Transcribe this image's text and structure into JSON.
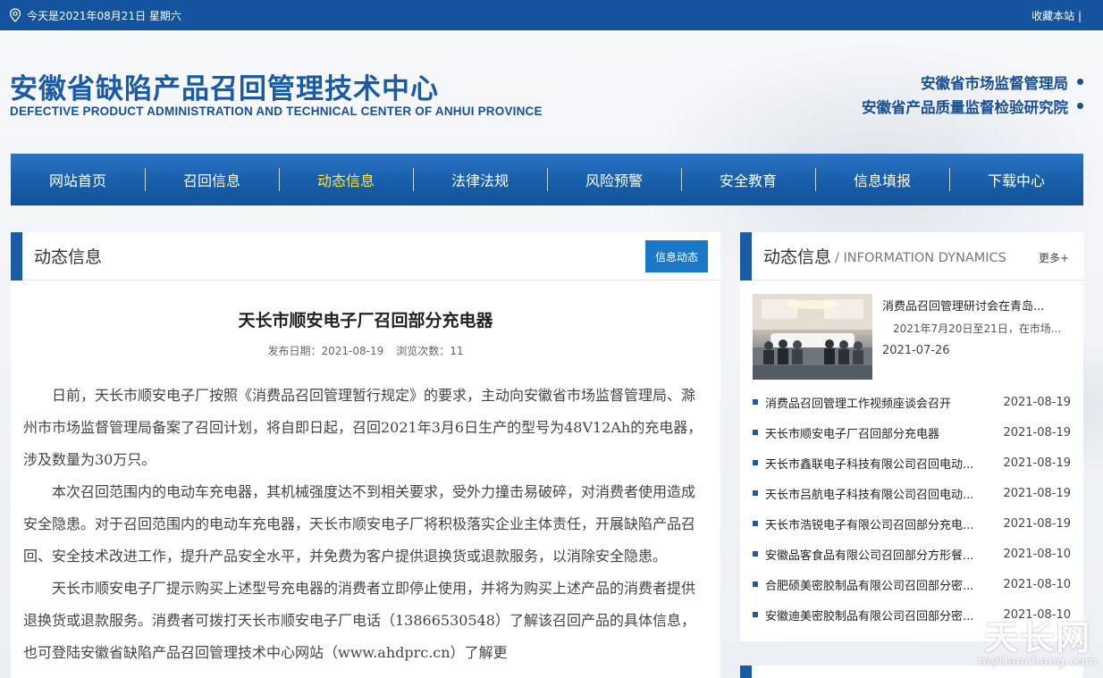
{
  "topbar": {
    "date_text": "今天是2021年08月21日 星期六",
    "bookmark": "收藏本站 |"
  },
  "header": {
    "title": "安徽省缺陷产品召回管理技术中心",
    "subtitle": "DEFECTIVE PRODUCT ADMINISTRATION AND TECHNICAL CENTER OF ANHUI PROVINCE",
    "orgs": [
      "安徽省市场监督管理局",
      "安徽省产品质量监督检验研究院"
    ]
  },
  "nav": {
    "items": [
      "网站首页",
      "召回信息",
      "动态信息",
      "法律法规",
      "风险预警",
      "安全教育",
      "信息填报",
      "下载中心"
    ],
    "active_index": 2
  },
  "main": {
    "panel_title": "动态信息",
    "tag_button": "信息动态",
    "article": {
      "title": "天长市顺安电子厂召回部分充电器",
      "publish_date": "发布日期：2021-08-19",
      "views": "浏览次数：11",
      "paragraphs": [
        "日前，天长市顺安电子厂按照《消费品召回管理暂行规定》的要求，主动向安徽省市场监督管理局、滁州市市场监督管理局备案了召回计划，将自即日起，召回2021年3月6日生产的型号为48V12Ah的充电器，涉及数量为30万只。",
        "本次召回范围内的电动车充电器，其机械强度达不到相关要求，受外力撞击易破碎，对消费者使用造成安全隐患。对于召回范围内的电动车充电器，天长市顺安电子厂将积极落实企业主体责任，开展缺陷产品召回、安全技术改进工作，提升产品安全水平，并免费为客户提供退换货或退款服务，以消除安全隐患。",
        "天长市顺安电子厂提示购买上述型号充电器的消费者立即停止使用，并将为购买上述产品的消费者提供退换货或退款服务。消费者可拨打天长市顺安电子厂电话（13866530548）了解该召回产品的具体信息，也可登陆安徽省缺陷产品召回管理技术中心网站（www.ahdprc.cn）了解更"
      ]
    }
  },
  "sidebar": {
    "title": "动态信息",
    "subtitle": "/ INFORMATION DYNAMICS",
    "more": "更多+",
    "featured": {
      "title": "消费品召回管理研讨会在青岛...",
      "desc": "2021年7月20日至21日，在市场...",
      "date": "2021-07-26"
    },
    "items": [
      {
        "text": "消费品召回管理工作视频座谈会召开",
        "date": "2021-08-19"
      },
      {
        "text": "天长市顺安电子厂召回部分充电器",
        "date": "2021-08-19"
      },
      {
        "text": "天长市鑫联电子科技有限公司召回电动...",
        "date": "2021-08-19"
      },
      {
        "text": "天长市吕航电子科技有限公司召回电动...",
        "date": "2021-08-19"
      },
      {
        "text": "天长市浩锐电子有限公司召回部分充电...",
        "date": "2021-08-19"
      },
      {
        "text": "安徽品客食品有限公司召回部分方形餐...",
        "date": "2021-08-10"
      },
      {
        "text": "合肥硕美密胶制品有限公司召回部分密...",
        "date": "2021-08-10"
      },
      {
        "text": "安徽迪美密胶制品有限公司召回部分密...",
        "date": "2021-08-10"
      }
    ]
  },
  "watermark": {
    "logo": "天长网",
    "url": "mytianchang.com"
  }
}
